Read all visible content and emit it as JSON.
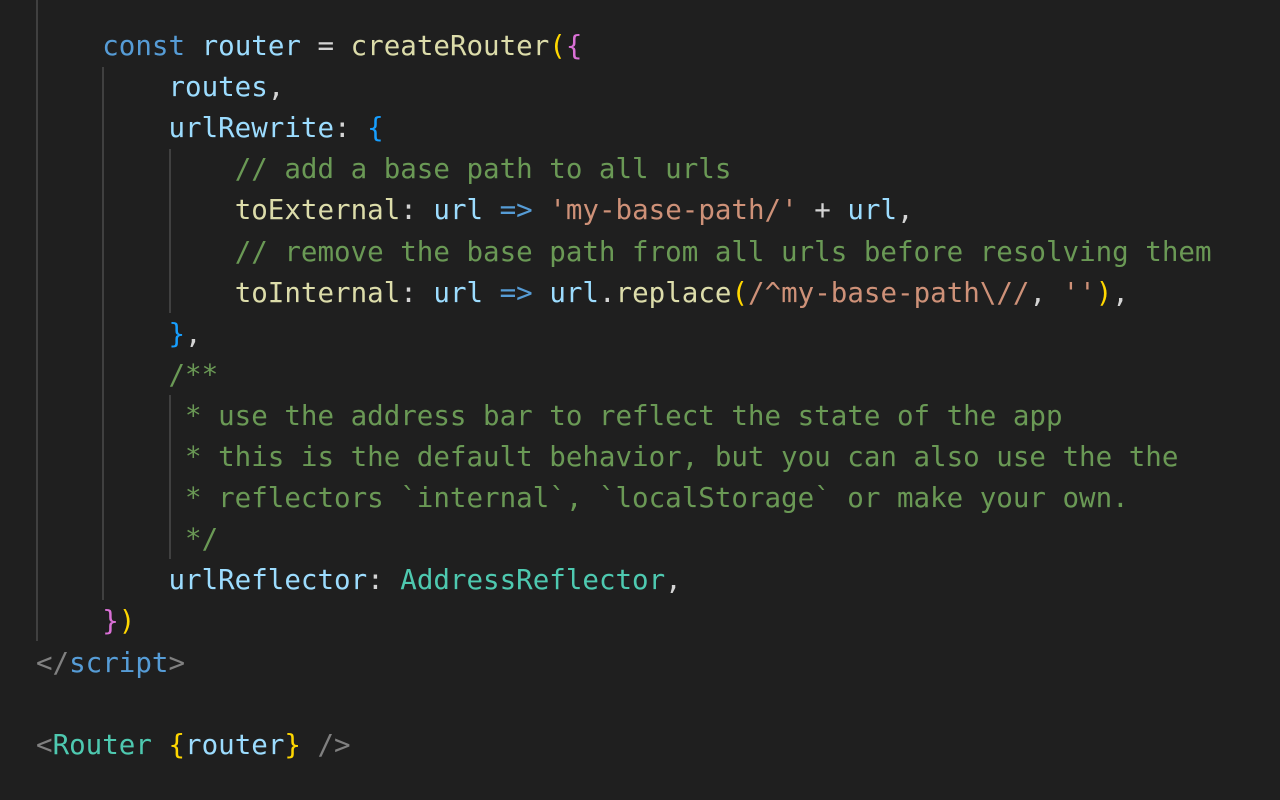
{
  "editor": {
    "colors": {
      "background": "#1f1f1f",
      "keyword": "#569cd6",
      "variable": "#9cdcfe",
      "function": "#dcdcaa",
      "string": "#ce9178",
      "comment": "#6a9955",
      "type": "#4ec9b0",
      "bracket_level_1": "#ffd700",
      "bracket_level_2": "#da70d6",
      "bracket_level_3": "#179fff",
      "tag_punctuation": "#808080",
      "indent_guide": "#404040"
    },
    "lines": [
      {
        "tokens": [
          {
            "t": "    "
          },
          {
            "t": "const",
            "c": "k"
          },
          {
            "t": " "
          },
          {
            "t": "router",
            "c": "v"
          },
          {
            "t": " = "
          },
          {
            "t": "createRouter",
            "c": "f"
          },
          {
            "t": "(",
            "c": "p1"
          },
          {
            "t": "{",
            "c": "p2"
          }
        ]
      },
      {
        "tokens": [
          {
            "t": "        "
          },
          {
            "t": "routes",
            "c": "v"
          },
          {
            "t": ","
          }
        ]
      },
      {
        "tokens": [
          {
            "t": "        "
          },
          {
            "t": "urlRewrite",
            "c": "v"
          },
          {
            "t": ": "
          },
          {
            "t": "{",
            "c": "p3"
          }
        ]
      },
      {
        "tokens": [
          {
            "t": "            "
          },
          {
            "t": "// add a base path to all urls",
            "c": "c"
          }
        ]
      },
      {
        "tokens": [
          {
            "t": "            "
          },
          {
            "t": "toExternal",
            "c": "f"
          },
          {
            "t": ": "
          },
          {
            "t": "url",
            "c": "v"
          },
          {
            "t": " "
          },
          {
            "t": "=>",
            "c": "k"
          },
          {
            "t": " "
          },
          {
            "t": "'my-base-path/'",
            "c": "s"
          },
          {
            "t": " + "
          },
          {
            "t": "url",
            "c": "v"
          },
          {
            "t": ","
          }
        ]
      },
      {
        "tokens": [
          {
            "t": "            "
          },
          {
            "t": "// remove the base path from all urls before resolving them",
            "c": "c"
          }
        ]
      },
      {
        "tokens": [
          {
            "t": "            "
          },
          {
            "t": "toInternal",
            "c": "f"
          },
          {
            "t": ": "
          },
          {
            "t": "url",
            "c": "v"
          },
          {
            "t": " "
          },
          {
            "t": "=>",
            "c": "k"
          },
          {
            "t": " "
          },
          {
            "t": "url",
            "c": "v"
          },
          {
            "t": "."
          },
          {
            "t": "replace",
            "c": "f"
          },
          {
            "t": "(",
            "c": "p1"
          },
          {
            "t": "/^my-base-path\\//",
            "c": "s"
          },
          {
            "t": ", "
          },
          {
            "t": "''",
            "c": "s"
          },
          {
            "t": ")",
            "c": "p1"
          },
          {
            "t": ","
          }
        ]
      },
      {
        "tokens": [
          {
            "t": "        "
          },
          {
            "t": "}",
            "c": "p3"
          },
          {
            "t": ","
          }
        ]
      },
      {
        "tokens": [
          {
            "t": "        "
          },
          {
            "t": "/**",
            "c": "c"
          }
        ]
      },
      {
        "tokens": [
          {
            "t": "         "
          },
          {
            "t": "* use the address bar to reflect the state of the app",
            "c": "c"
          }
        ]
      },
      {
        "tokens": [
          {
            "t": "         "
          },
          {
            "t": "* this is the default behavior, but you can also use the the",
            "c": "c"
          }
        ]
      },
      {
        "tokens": [
          {
            "t": "         "
          },
          {
            "t": "* reflectors `internal`, `localStorage` or make your own.",
            "c": "c"
          }
        ]
      },
      {
        "tokens": [
          {
            "t": "         "
          },
          {
            "t": "*/",
            "c": "c"
          }
        ]
      },
      {
        "tokens": [
          {
            "t": "        "
          },
          {
            "t": "urlReflector",
            "c": "v"
          },
          {
            "t": ": "
          },
          {
            "t": "AddressReflector",
            "c": "t"
          },
          {
            "t": ","
          }
        ]
      },
      {
        "tokens": [
          {
            "t": "    "
          },
          {
            "t": "}",
            "c": "p2"
          },
          {
            "t": ")",
            "c": "p1"
          }
        ]
      },
      {
        "tokens": [
          {
            "t": "</",
            "c": "tg"
          },
          {
            "t": "script",
            "c": "k"
          },
          {
            "t": ">",
            "c": "tg"
          }
        ]
      },
      {
        "tokens": []
      },
      {
        "tokens": [
          {
            "t": "<",
            "c": "tg"
          },
          {
            "t": "Router",
            "c": "t"
          },
          {
            "t": " "
          },
          {
            "t": "{",
            "c": "p1"
          },
          {
            "t": "router",
            "c": "v"
          },
          {
            "t": "}",
            "c": "p1"
          },
          {
            "t": " "
          },
          {
            "t": "/>",
            "c": "tg"
          }
        ]
      }
    ]
  }
}
